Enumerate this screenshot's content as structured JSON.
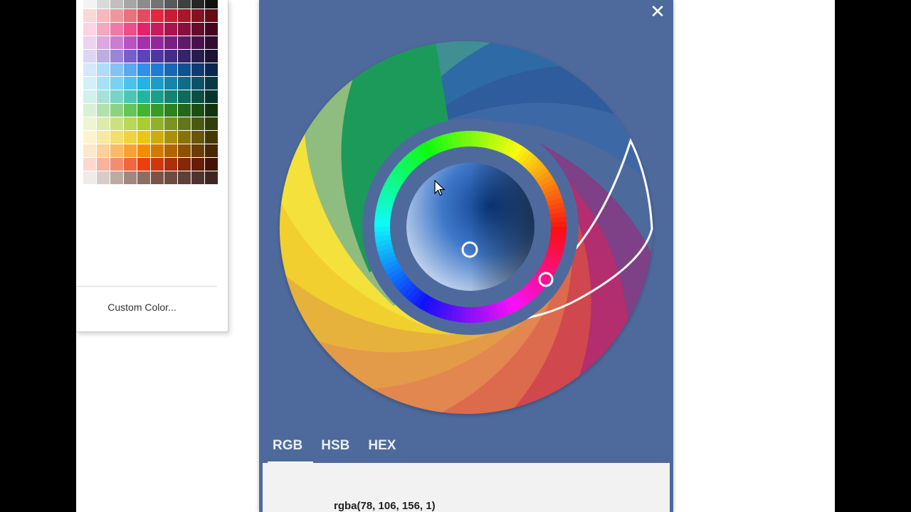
{
  "palette": {
    "custom_color_label": "Custom Color...",
    "rows": [
      [
        "#f3f3f3",
        "#d9d9d9",
        "#bfbfbf",
        "#a6a6a6",
        "#8c8c8c",
        "#737373",
        "#595959",
        "#404040",
        "#262626",
        "#111111"
      ],
      [
        "#f8d7d9",
        "#f4b8bd",
        "#ef959e",
        "#ea717e",
        "#e54b5d",
        "#e0283f",
        "#c71d34",
        "#a7162a",
        "#861121",
        "#650b17"
      ],
      [
        "#fbd3e2",
        "#f6a7c4",
        "#f07aa7",
        "#eb4e8a",
        "#e5226d",
        "#c91a5e",
        "#a8144e",
        "#86103e",
        "#640b2e",
        "#42071e"
      ],
      [
        "#ecd4ef",
        "#dba9df",
        "#c97ecf",
        "#b853bf",
        "#a62faf",
        "#92279a",
        "#7a2081",
        "#611a67",
        "#48134d",
        "#300c33"
      ],
      [
        "#ddd6f1",
        "#bcaee3",
        "#9a86d5",
        "#795ec7",
        "#5d43b5",
        "#4f389b",
        "#422f81",
        "#352567",
        "#281c4d",
        "#1a1233"
      ],
      [
        "#d6e6fb",
        "#addcf7",
        "#84c2f3",
        "#5aa8ee",
        "#318eea",
        "#1f7bd6",
        "#1966b4",
        "#135092",
        "#0e3b70",
        "#08264e"
      ],
      [
        "#d2f0fa",
        "#a6e1f5",
        "#79d2f0",
        "#4dc3eb",
        "#21b4e6",
        "#1a9ec9",
        "#1585a8",
        "#106b87",
        "#0b5266",
        "#073845"
      ],
      [
        "#d2f0ec",
        "#a6e2d9",
        "#79d3c6",
        "#4dc5b3",
        "#21b6a0",
        "#1a9d89",
        "#158372",
        "#10695b",
        "#0b4f44",
        "#07352e"
      ],
      [
        "#d9f0d6",
        "#b3e1ad",
        "#8dd284",
        "#67c35b",
        "#41b432",
        "#379a2a",
        "#2e8023",
        "#25661c",
        "#1c4d15",
        "#12330e"
      ],
      [
        "#eef5d2",
        "#dcebaa",
        "#cbe181",
        "#b9d759",
        "#a8cd30",
        "#91b128",
        "#799421",
        "#61771a",
        "#4a5914",
        "#323c0d"
      ],
      [
        "#fbf4cf",
        "#f7e99f",
        "#f3de6f",
        "#efd33f",
        "#ebc80f",
        "#ccad0c",
        "#aa900a",
        "#887308",
        "#665606",
        "#443904"
      ],
      [
        "#fde8cc",
        "#fbd199",
        "#f9ba66",
        "#f7a333",
        "#f58c00",
        "#d47900",
        "#b16500",
        "#8e5100",
        "#6a3d00",
        "#472800"
      ],
      [
        "#fbd9cf",
        "#f7b39f",
        "#f38d6f",
        "#ef673f",
        "#eb410f",
        "#cc380c",
        "#aa2f0a",
        "#882608",
        "#661c06",
        "#441304"
      ],
      [
        "#efebe9",
        "#d7ccc8",
        "#bcaaa4",
        "#a1887f",
        "#8d6e63",
        "#795548",
        "#6d4c41",
        "#5d4037",
        "#4e342e",
        "#3e2723"
      ]
    ]
  },
  "picker": {
    "background": "#4e6a9c",
    "close_icon": "close-icon",
    "tabs": [
      "RGB",
      "HSB",
      "HEX"
    ],
    "active_tab": "RGB",
    "current_value": "rgba(78, 106, 156, 1)"
  }
}
